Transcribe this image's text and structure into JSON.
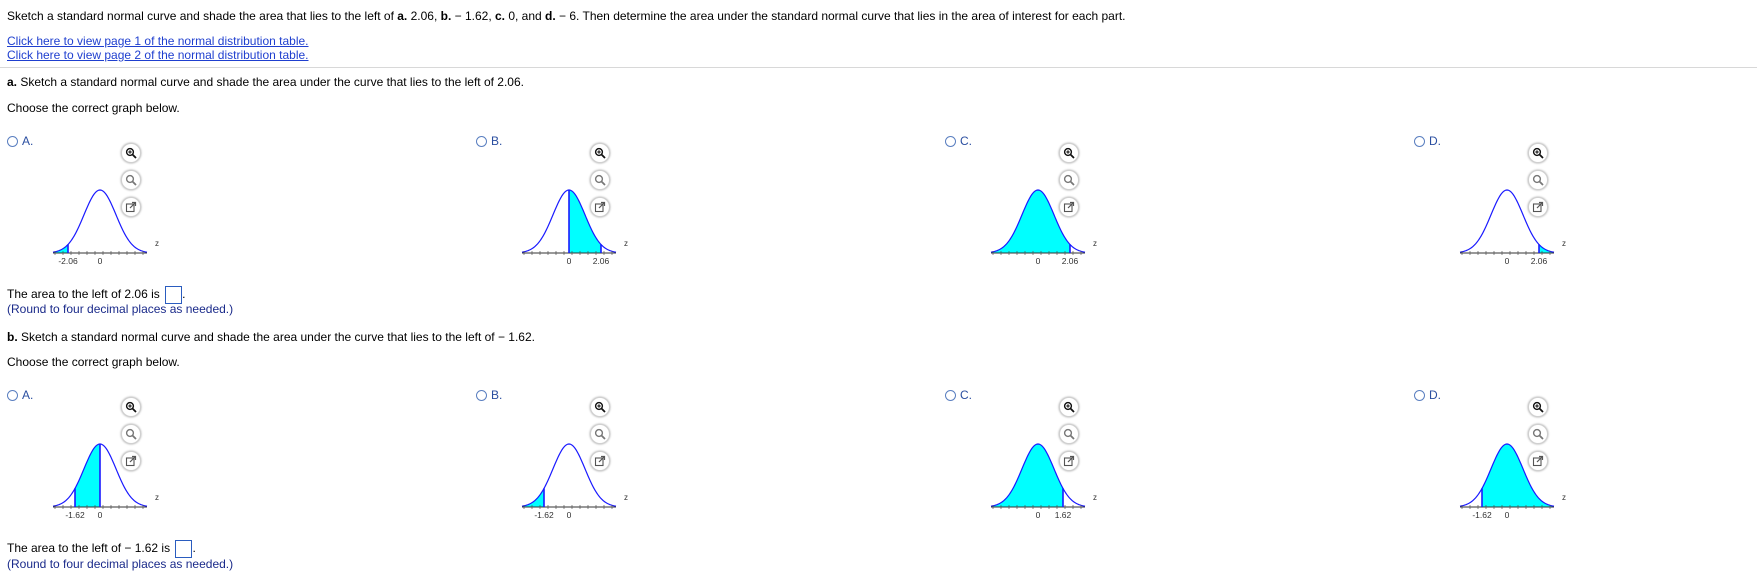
{
  "question": {
    "instruction_pre": "Sketch a standard normal curve and shade the area that lies to the left of ",
    "a_lbl": "a.",
    "a_val": " 2.06, ",
    "b_lbl": "b.",
    "b_val": " − 1.62, ",
    "c_lbl": "c.",
    "c_val": " 0, and ",
    "d_lbl": "d.",
    "d_val": " − 6. Then determine the area under the standard normal curve that lies in the area of interest for each part."
  },
  "links": {
    "table_page_1": "Click here to view page 1 of the normal distribution table.",
    "table_page_2": "Click here to view page 2 of the normal distribution table."
  },
  "part_a": {
    "label": "a.",
    "prompt": " Sketch a standard normal curve and shade the area under the curve that lies to the left of 2.06.",
    "choose": "Choose the correct graph below.",
    "options": [
      {
        "letter": "A.",
        "ticks": [
          "-2.06",
          "0"
        ],
        "z": "z"
      },
      {
        "letter": "B.",
        "ticks": [
          "0",
          "2.06"
        ],
        "z": "z"
      },
      {
        "letter": "C.",
        "ticks": [
          "0",
          "2.06"
        ],
        "z": "z"
      },
      {
        "letter": "D.",
        "ticks": [
          "0",
          "2.06"
        ],
        "z": "z"
      }
    ],
    "answer_prefix": "The area to the left of 2.06 is ",
    "answer_suffix": ".",
    "answer_value": "",
    "round_hint": "(Round to four decimal places as needed.)"
  },
  "part_b": {
    "label": "b.",
    "prompt": " Sketch a standard normal curve and shade the area under the curve that lies to the left of  − 1.62.",
    "choose": "Choose the correct graph below.",
    "options": [
      {
        "letter": "A.",
        "ticks": [
          "-1.62",
          "0"
        ],
        "z": "z"
      },
      {
        "letter": "B.",
        "ticks": [
          "-1.62",
          "0"
        ],
        "z": "z"
      },
      {
        "letter": "C.",
        "ticks": [
          "0",
          "1.62"
        ],
        "z": "z"
      },
      {
        "letter": "D.",
        "ticks": [
          "-1.62",
          "0"
        ],
        "z": "z"
      }
    ],
    "answer_prefix": "The area to the left of  − 1.62 is ",
    "answer_suffix": ".",
    "answer_value": "",
    "round_hint": "(Round to four decimal places as needed.)"
  },
  "colors": {
    "curve": "#1a1aff",
    "shade": "#00ffff",
    "link": "#1f3fcf",
    "option_text": "#2a4ea0"
  },
  "icons": [
    "zoom-in-icon",
    "zoom-out-icon",
    "open-in-new-window-icon"
  ]
}
